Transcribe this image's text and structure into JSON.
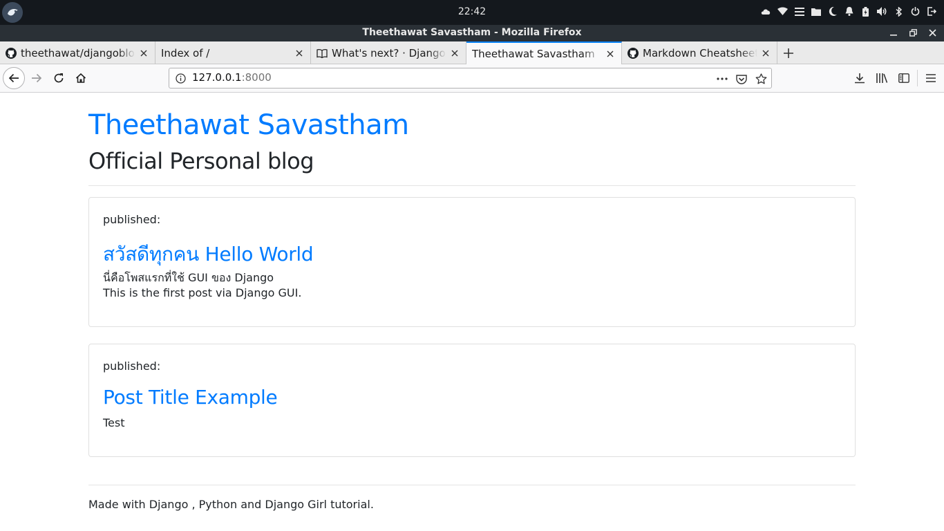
{
  "os": {
    "clock": "22:42",
    "tray_icons": [
      "cloud-icon",
      "wifi-icon",
      "menu-icon",
      "folder-icon",
      "moon-icon",
      "bell-icon",
      "battery-icon",
      "volume-icon",
      "bluetooth-icon",
      "power-icon",
      "logout-icon"
    ]
  },
  "window": {
    "title": "Theethawat Savastham - Mozilla Firefox"
  },
  "tabs": [
    {
      "label": "theethawat/djangoblog",
      "icon": "github-icon"
    },
    {
      "label": "Index of /",
      "icon": ""
    },
    {
      "label": "What's next? · Django Girls",
      "icon": "book-icon"
    },
    {
      "label": "Theethawat Savastham",
      "icon": ""
    },
    {
      "label": "Markdown Cheatsheet",
      "icon": "github-icon"
    }
  ],
  "nav": {
    "url_host": "127.0.0.1",
    "url_port": ":8000"
  },
  "page": {
    "site_title": "Theethawat Savastham",
    "site_subtitle": "Official Personal blog",
    "posts": [
      {
        "date_label": "published:",
        "title": "สวัสดีทุกคน Hello World",
        "lines": [
          "นี่คือโพสแรกที่ใช้ GUI ของ Django",
          "This is the first post via Django GUI."
        ]
      },
      {
        "date_label": "published:",
        "title": "Post Title Example",
        "lines": [
          "Test"
        ]
      }
    ],
    "footer": "Made with Django , Python and Django Girl tutorial."
  },
  "colors": {
    "link": "#007bff",
    "active_tab_accent": "#0a84ff",
    "os_bar": "#14181d",
    "title_bar": "#2a3036"
  }
}
